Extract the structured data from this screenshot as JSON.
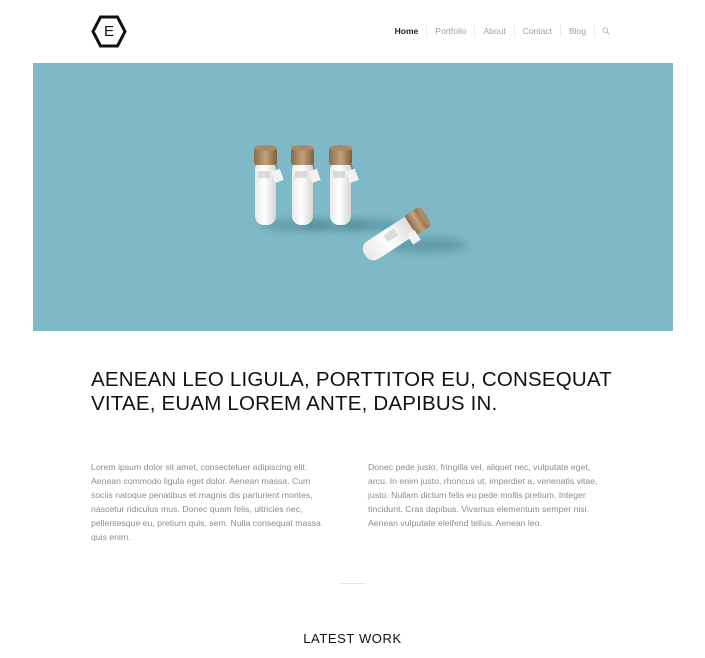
{
  "logo": {
    "letter": "E",
    "icon": "hexagon-logo-icon"
  },
  "nav": {
    "items": [
      {
        "label": "Home",
        "active": true
      },
      {
        "label": "Portfolio",
        "active": false
      },
      {
        "label": "About",
        "active": false
      },
      {
        "label": "Contact",
        "active": false
      },
      {
        "label": "Blog",
        "active": false
      }
    ],
    "search_icon": "search-icon"
  },
  "hero": {
    "background": "#7fb9c7",
    "image": "bottles-image"
  },
  "content": {
    "headline": "AENEAN LEO LIGULA, PORTTITOR EU, CONSEQUAT VITAE, EUAM LOREM ANTE, DAPIBUS IN.",
    "column_left": "Lorem ipsum dolor sit amet, consectetuer adipiscing elit. Aenean commodo ligula eget dolor. Aenean massa. Cum sociis natoque penatibus et magnis dis parturient montes, nascetur ridiculus mus. Donec quam felis, ultricies nec, pellentesque eu, pretium quis, sem. Nulla consequat massa quis enim.",
    "column_right": "Donec pede justo, fringilla vel, aliquet nec, vulputate eget, arcu. In enim justo, rhoncus ut, imperdiet a, venenatis vitae, justo. Nullam dictum felis eu pede mollis pretium. Integer tincidunt. Cras dapibus. Vivamus elementum semper nisi. Aenean vulputate eleifend tellus. Aenean leo."
  },
  "latest_work": {
    "title": "LATEST WORK"
  }
}
